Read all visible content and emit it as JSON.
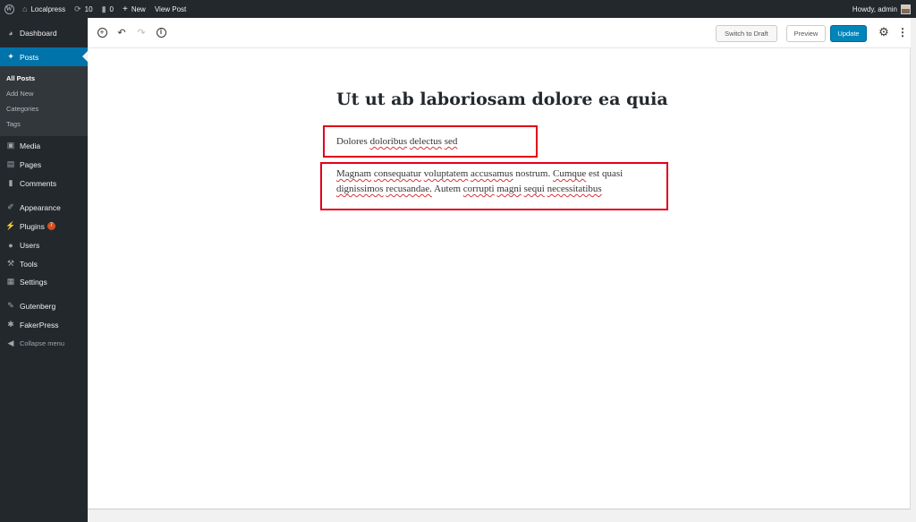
{
  "adminbar": {
    "site_name": "Localpress",
    "updates_count": "10",
    "comments_count": "0",
    "new_label": "New",
    "view_post_label": "View Post",
    "greeting": "Howdy, admin"
  },
  "sidebar": {
    "dashboard": "Dashboard",
    "posts": "Posts",
    "submenu": [
      "All Posts",
      "Add New",
      "Categories",
      "Tags"
    ],
    "media": "Media",
    "pages": "Pages",
    "comments": "Comments",
    "appearance": "Appearance",
    "plugins": "Plugins",
    "plugins_badge": "7",
    "users": "Users",
    "tools": "Tools",
    "settings": "Settings",
    "gutenberg": "Gutenberg",
    "fakerpress": "FakerPress",
    "collapse": "Collapse menu"
  },
  "toolbar": {
    "switch_to_draft": "Switch to Draft",
    "preview": "Preview",
    "update": "Update"
  },
  "post": {
    "title": "Ut ut ab laboriosam dolore ea quia",
    "paragraph1": [
      "Dolores",
      "doloribus",
      "delectus",
      "sed"
    ],
    "paragraph2_line1": [
      "Magnam",
      "consequatur",
      "voluptatem",
      "accusamus",
      "nostrum.",
      "Cumque",
      "est",
      "quasi"
    ],
    "paragraph2_line2": [
      "dignissimos",
      "recusandae.",
      "Autem",
      "corrupti",
      "magni",
      "sequi",
      "necessitatibus"
    ]
  },
  "colors": {
    "admin_dark": "#23282d",
    "accent": "#0073aa",
    "highlight": "#e0001b"
  }
}
